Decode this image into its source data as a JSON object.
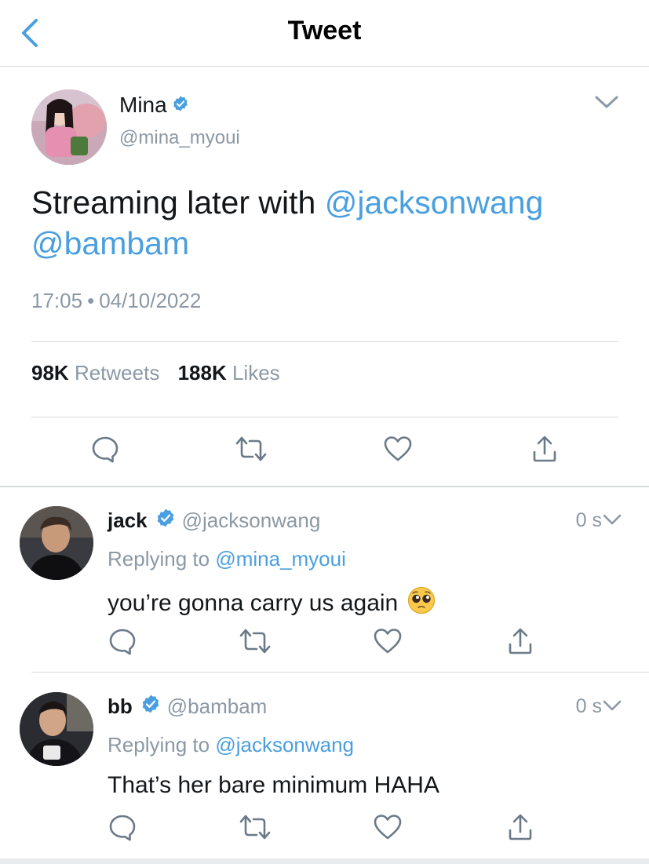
{
  "header": {
    "title": "Tweet",
    "back_icon": "chevron-left-icon"
  },
  "tweet": {
    "author": {
      "name": "Mina",
      "handle": "@mina_myoui",
      "verified": true
    },
    "text": {
      "prefix": "Streaming later with ",
      "mention1": "@jacksonwang",
      "mention2": "@bambam"
    },
    "time": "17:05",
    "separator": "•",
    "date": "04/10/2022",
    "stats": {
      "retweets_count": "98K",
      "retweets_label": "Retweets",
      "likes_count": "188K",
      "likes_label": "Likes"
    }
  },
  "replies": [
    {
      "name": "jack",
      "handle": "@jacksonwang",
      "verified": true,
      "time": "0 s",
      "replying_prefix": "Replying to ",
      "replying_to": "@mina_myoui",
      "text": "you’re gonna carry us again",
      "emoji": "pleading-face-emoji"
    },
    {
      "name": "bb",
      "handle": "@bambam",
      "verified": true,
      "time": "0 s",
      "replying_prefix": "Replying to ",
      "replying_to": "@jacksonwang",
      "text": "That’s her bare minimum HAHA"
    }
  ],
  "colors": {
    "accent": "#4a9fe0",
    "secondary_text": "#8b98a5",
    "divider": "#d6d9db",
    "icon": "#6b7a88"
  }
}
